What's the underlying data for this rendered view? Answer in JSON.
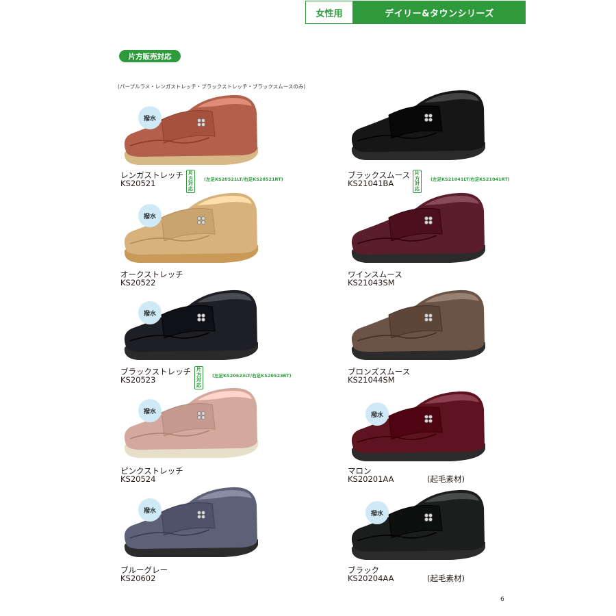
{
  "header": {
    "category": "女性用",
    "series": "デイリー&タウンシリーズ"
  },
  "badge": "片方販売対応",
  "note": "(パープルラメ・レンガストレッチ・ブラックストレッチ・ブラックスムースのみ)",
  "water_label": "撥水",
  "katahou_tag": "片方\n対応",
  "products": [
    {
      "name": "レンガストレッチ",
      "code": "KS20521",
      "lr_note": "(左足KS20521LT/右足KS20521RT)",
      "material": "",
      "color": "#b2604b",
      "sole": "#d8b887",
      "water": true
    },
    {
      "name": "オークストレッチ",
      "code": "KS20522",
      "lr_note": "",
      "material": "",
      "color": "#d7b27c",
      "sole": "#c99a57",
      "water": true
    },
    {
      "name": "ブラックストレッチ",
      "code": "KS20523",
      "lr_note": "(左足KS20523LT/右足KS20523RT)",
      "material": "",
      "color": "#1e1f24",
      "sole": "#2a2a2a",
      "water": true
    },
    {
      "name": "ピンクストレッチ",
      "code": "KS20524",
      "lr_note": "",
      "material": "",
      "color": "#d2a99c",
      "sole": "#e8dfc8",
      "water": true
    },
    {
      "name": "ブルーグレー",
      "code": "KS20602",
      "lr_note": "",
      "material": "",
      "color": "#5e6077",
      "sole": "#2b2b2b",
      "water": true
    },
    {
      "name": "ブラックスムース",
      "code": "KS21041BA",
      "lr_note": "(左足KS21041LT/右足KS21041RT)",
      "material": "",
      "color": "#161616",
      "sole": "#2a2a2a",
      "water": false
    },
    {
      "name": "ワインスムース",
      "code": "KS21043SM",
      "lr_note": "",
      "material": "",
      "color": "#5a1d2c",
      "sole": "#2b2b2b",
      "water": false
    },
    {
      "name": "ブロンズスムース",
      "code": "KS21044SM",
      "lr_note": "",
      "material": "",
      "color": "#6b5446",
      "sole": "#2b2b2b",
      "water": false
    },
    {
      "name": "マロン",
      "code": "KS20201AA",
      "lr_note": "",
      "material": "(起毛素材)",
      "color": "#5e1420",
      "sole": "#2b2b2b",
      "water": true
    },
    {
      "name": "ブラック",
      "code": "KS20204AA",
      "lr_note": "",
      "material": "(起毛素材)",
      "color": "#1c1e1e",
      "sole": "#2b2b2b",
      "water": true
    }
  ],
  "page_number": "6"
}
